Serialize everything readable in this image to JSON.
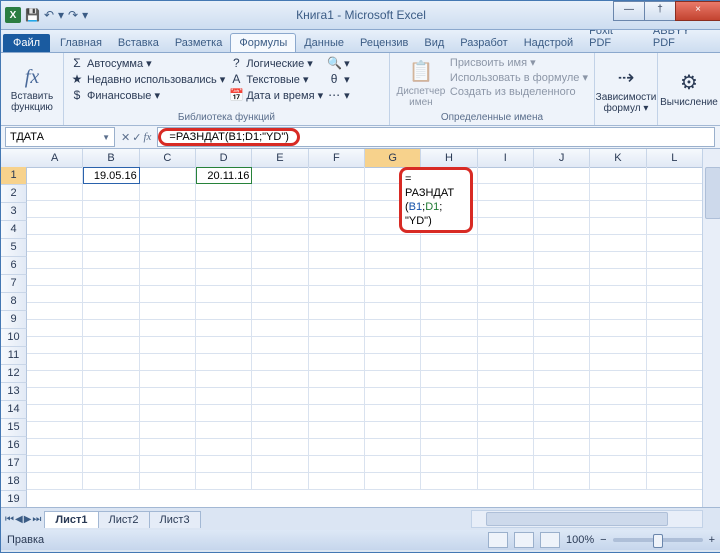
{
  "title": "Книга1 - Microsoft Excel",
  "qat": {
    "save": "💾",
    "undo": "↶",
    "redo": "↷",
    "dd": "▾"
  },
  "winbtns": {
    "min": "—",
    "max": "†",
    "close": "×"
  },
  "filetab": "Файл",
  "tabs": [
    "Главная",
    "Вставка",
    "Разметка",
    "Формулы",
    "Данные",
    "Рецензив",
    "Вид",
    "Разработ",
    "Надстрой",
    "Foxit PDF",
    "ABBYY PDF"
  ],
  "active_tab_index": 3,
  "ribbon": {
    "g1": {
      "label": "Вставить функцию",
      "btn": "Вставить\nфункцию",
      "ic": "fx"
    },
    "g2": {
      "label": "Библиотека функций",
      "r1": {
        "ic": "Σ",
        "t": "Автосумма ▾"
      },
      "r2": {
        "ic": "★",
        "t": "Недавно использовались ▾"
      },
      "r3": {
        "ic": "$",
        "t": "Финансовые ▾"
      },
      "r4": {
        "ic": "?",
        "t": "Логические ▾"
      },
      "r5": {
        "ic": "A",
        "t": "Текстовые ▾"
      },
      "r6": {
        "ic": "📅",
        "t": "Дата и время ▾"
      },
      "r7": {
        "ic": "🔍",
        "t": "▾"
      },
      "r8": {
        "ic": "θ",
        "t": "▾"
      },
      "r9": {
        "ic": "⋯",
        "t": "▾"
      }
    },
    "g3": {
      "label": "",
      "btn": "Диспетчер\nимен",
      "ic": "📋",
      "r1": "Присвоить имя ▾",
      "r2": "Использовать в формуле ▾",
      "r3": "Создать из выделенного",
      "sub": "Определенные имена"
    },
    "g4": {
      "btn": "Зависимости\nформул ▾",
      "ic": "⇢"
    },
    "g5": {
      "btn": "Вычисление",
      "ic": "⚙"
    }
  },
  "namebox": "ТДАТА",
  "fbarbtns": {
    "cancel": "✕",
    "enter": "✓",
    "fx": "fx"
  },
  "formula": "=РАЗНДАТ(B1;D1;\"YD\")",
  "columns": [
    "A",
    "B",
    "C",
    "D",
    "E",
    "F",
    "G",
    "H",
    "I",
    "J",
    "K",
    "L"
  ],
  "rows": [
    "1",
    "2",
    "3",
    "4",
    "5",
    "6",
    "7",
    "8",
    "9",
    "10",
    "11",
    "12",
    "13",
    "14",
    "15",
    "16",
    "17",
    "18",
    "19"
  ],
  "cells": {
    "B1": "19.05.16",
    "D1": "20.11.16"
  },
  "editbox": {
    "l1": "=",
    "l2": "РАЗНДАТ",
    "l3a": "(",
    "l3b": "B1",
    "l3c": ";",
    "l3d": "D1",
    "l3e": ";",
    "l4": "\"YD\")"
  },
  "sheets": [
    "Лист1",
    "Лист2",
    "Лист3"
  ],
  "active_sheet_index": 0,
  "status": {
    "left": "Правка",
    "zoom": "100%",
    "minus": "−",
    "plus": "+"
  }
}
